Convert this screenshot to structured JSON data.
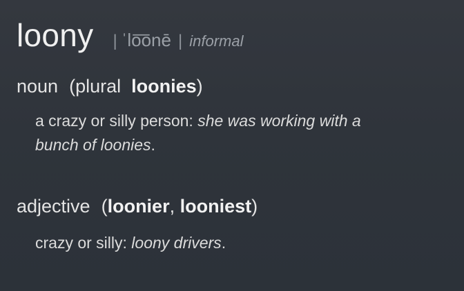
{
  "entry": {
    "headword": "loony",
    "pronunciation": "ˈlo͞onē",
    "separator": "|",
    "register": "informal"
  },
  "senses": [
    {
      "pos": "noun",
      "forms_open": "(plural",
      "form1": "loonies",
      "forms_close": ")",
      "definition": "a crazy or silly person: ",
      "example_line1": "she was working with a",
      "example_line2": "bunch of loonies",
      "end": "."
    },
    {
      "pos": "adjective",
      "forms_open": "(",
      "form1": "loonier",
      "comma": ", ",
      "form2": "looniest",
      "forms_close": ")",
      "definition": "crazy or silly: ",
      "example": "loony drivers",
      "end": "."
    }
  ]
}
